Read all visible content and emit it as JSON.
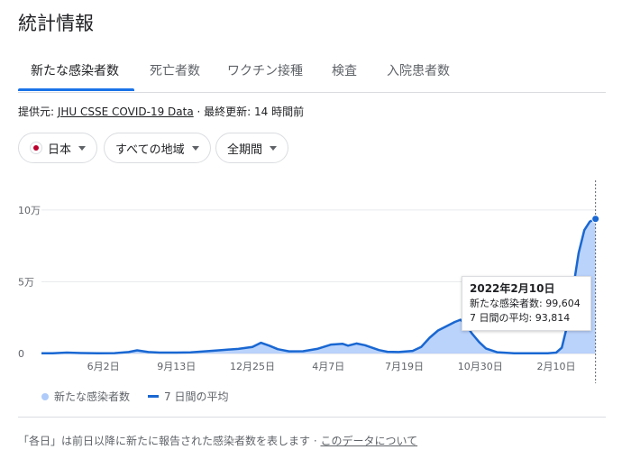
{
  "header": {
    "title": "統計情報"
  },
  "tabs": [
    {
      "label": "新たな感染者数",
      "active": true
    },
    {
      "label": "死亡者数"
    },
    {
      "label": "ワクチン接種"
    },
    {
      "label": "検査"
    },
    {
      "label": "入院患者数"
    }
  ],
  "source": {
    "prefix": "提供元: ",
    "link": "JHU CSSE COVID-19 Data",
    "separator": " · ",
    "updated": "最終更新: 14 時間前"
  },
  "filters": {
    "country": "日本",
    "region": "すべての地域",
    "period": "全期間"
  },
  "tooltip": {
    "date": "2022年2月10日",
    "cases_label": "新たな感染者数:",
    "cases_value": "99,604",
    "avg_label": "7 日間の平均:",
    "avg_value": "93,814"
  },
  "legend": {
    "bars": "新たな感染者数",
    "line": "7 日間の平均"
  },
  "footer": {
    "note": "「各日」は前日以降に新たに報告された感染者数を表します",
    "separator": " · ",
    "link": "このデータについて"
  },
  "colors": {
    "accent": "#1a73e8",
    "bars": "#aecbfa",
    "line": "#1967d2",
    "grid": "#e8eaed"
  },
  "chart_data": {
    "type": "area",
    "y_ticks": [
      {
        "value": 0,
        "label": "0"
      },
      {
        "value": 50000,
        "label": "5万"
      },
      {
        "value": 100000,
        "label": "10万"
      }
    ],
    "x_ticks": [
      {
        "t": 0.11,
        "label": "6月2日"
      },
      {
        "t": 0.24,
        "label": "9月13日"
      },
      {
        "t": 0.375,
        "label": "12月25日"
      },
      {
        "t": 0.51,
        "label": "4月7日"
      },
      {
        "t": 0.645,
        "label": "7月19日"
      },
      {
        "t": 0.78,
        "label": "10月30日"
      },
      {
        "t": 0.915,
        "label": "2月10日"
      }
    ],
    "ylim": [
      0,
      110000
    ],
    "series": [
      {
        "name": "7 日間の平均",
        "points": [
          [
            0,
            100
          ],
          [
            0.02,
            150
          ],
          [
            0.045,
            600
          ],
          [
            0.07,
            300
          ],
          [
            0.1,
            200
          ],
          [
            0.13,
            250
          ],
          [
            0.155,
            1000
          ],
          [
            0.17,
            2200
          ],
          [
            0.19,
            1000
          ],
          [
            0.21,
            600
          ],
          [
            0.24,
            600
          ],
          [
            0.265,
            800
          ],
          [
            0.29,
            1500
          ],
          [
            0.32,
            2400
          ],
          [
            0.35,
            3200
          ],
          [
            0.375,
            4500
          ],
          [
            0.39,
            7500
          ],
          [
            0.405,
            5500
          ],
          [
            0.42,
            3000
          ],
          [
            0.44,
            1500
          ],
          [
            0.465,
            1600
          ],
          [
            0.49,
            3200
          ],
          [
            0.515,
            6200
          ],
          [
            0.535,
            6800
          ],
          [
            0.545,
            5500
          ],
          [
            0.56,
            7000
          ],
          [
            0.575,
            5800
          ],
          [
            0.6,
            2400
          ],
          [
            0.615,
            1200
          ],
          [
            0.635,
            1000
          ],
          [
            0.66,
            1800
          ],
          [
            0.675,
            4500
          ],
          [
            0.69,
            11000
          ],
          [
            0.705,
            16000
          ],
          [
            0.72,
            19000
          ],
          [
            0.735,
            22000
          ],
          [
            0.745,
            23500
          ],
          [
            0.755,
            20000
          ],
          [
            0.765,
            14000
          ],
          [
            0.778,
            8000
          ],
          [
            0.79,
            3500
          ],
          [
            0.81,
            900
          ],
          [
            0.84,
            200
          ],
          [
            0.87,
            150
          ],
          [
            0.9,
            200
          ],
          [
            0.915,
            600
          ],
          [
            0.925,
            4000
          ],
          [
            0.935,
            20000
          ],
          [
            0.945,
            45000
          ],
          [
            0.955,
            70000
          ],
          [
            0.965,
            86000
          ],
          [
            0.975,
            92000
          ],
          [
            0.985,
            93814
          ]
        ]
      }
    ],
    "highlight": {
      "t": 0.985,
      "value": 93814
    }
  }
}
